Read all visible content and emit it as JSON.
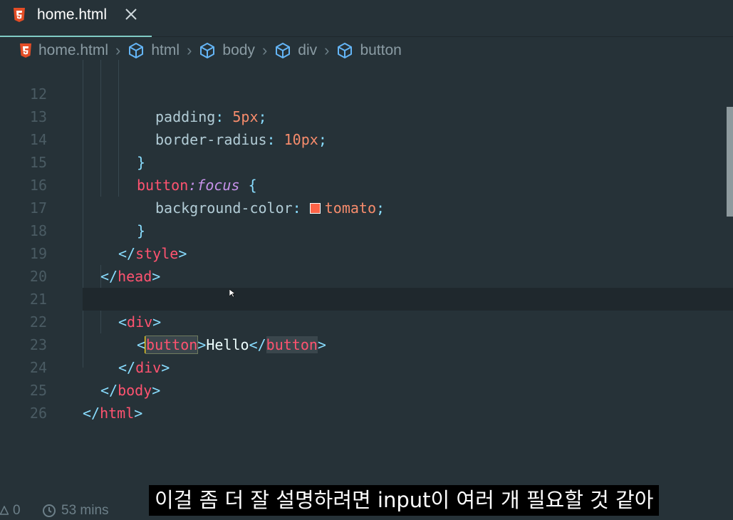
{
  "tab": {
    "filename": "home.html"
  },
  "breadcrumb": {
    "items": [
      "home.html",
      "html",
      "body",
      "div",
      "button"
    ]
  },
  "editor": {
    "line_numbers": [
      "12",
      "13",
      "14",
      "15",
      "16",
      "17",
      "18",
      "19",
      "20",
      "21",
      "22",
      "23",
      "24",
      "25",
      "26"
    ],
    "code": {
      "l12_prop": "padding",
      "l12_colon": ":",
      "l12_val": "5px",
      "l12_semi": ";",
      "l13_prop": "border-radius",
      "l13_colon": ":",
      "l13_val": "10px",
      "l13_semi": ";",
      "l14_close": "}",
      "l15_sel": "button",
      "l15_colon": ":",
      "l15_pseudo": "focus",
      "l15_open": "{",
      "l16_prop": "background-color",
      "l16_colon": ":",
      "l16_val": "tomato",
      "l16_semi": ";",
      "l17_close": "}",
      "l18_open": "</",
      "l18_tag": "style",
      "l18_close": ">",
      "l19_open": "</",
      "l19_tag": "head",
      "l19_close": ">",
      "l20_open": "<",
      "l20_tag": "body",
      "l20_close": ">",
      "l21_open": "<",
      "l21_tag": "div",
      "l21_close": ">",
      "l22_open": "<",
      "l22_tag": "button",
      "l22_close": ">",
      "l22_text": "Hello",
      "l22_end_open": "</",
      "l22_end_tag": "button",
      "l22_end_close": ">",
      "l23_open": "</",
      "l23_tag": "div",
      "l23_close": ">",
      "l24_open": "</",
      "l24_tag": "body",
      "l24_close": ">",
      "l25_open": "</",
      "l25_tag": "html",
      "l25_close": ">"
    }
  },
  "status": {
    "warnings": "0",
    "time": "53 mins"
  },
  "subtitle": "이걸 좀 더 잘 설명하려면 input이 여러 개 필요할 것 같아",
  "colors": {
    "accent": "#80cbc4",
    "tomato": "#ff6347",
    "html5": "#e44d26"
  }
}
